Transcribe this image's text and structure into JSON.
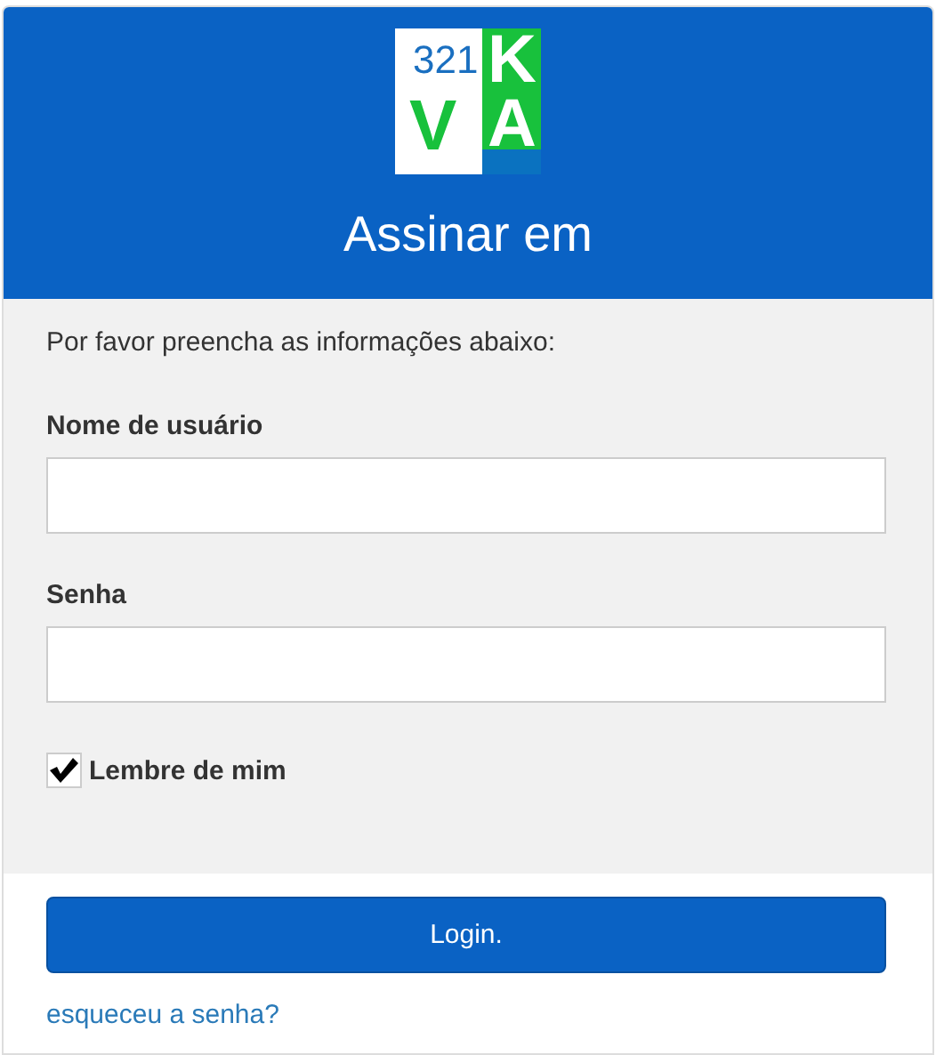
{
  "logo": {
    "number": "321",
    "letters": [
      "V",
      "A"
    ],
    "mark": "K"
  },
  "title": "Assinar em",
  "intro": "Por favor preencha as informações abaixo:",
  "fields": [
    {
      "label": "Nome de usuário"
    },
    {
      "label": "Senha"
    }
  ],
  "remember": {
    "label": "Lembre de mim",
    "checked": true
  },
  "login_button": "Login.",
  "forgot_link": "esqueceu a senha?"
}
